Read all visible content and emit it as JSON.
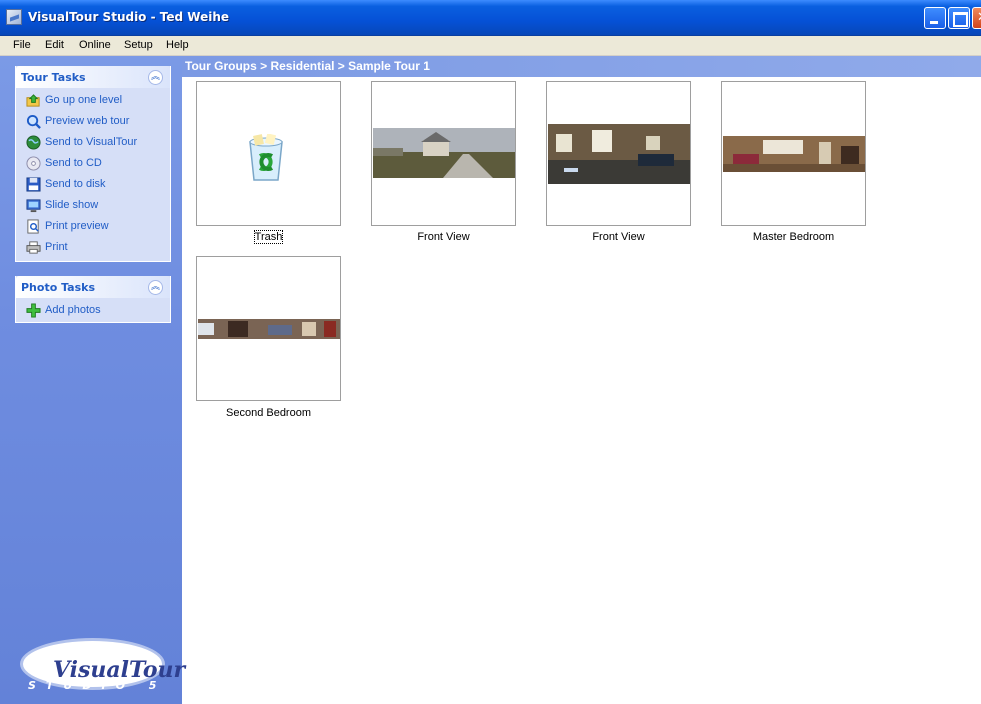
{
  "window": {
    "title": "VisualTour Studio - Ted Weihe"
  },
  "menu": [
    "File",
    "Edit",
    "Online",
    "Setup",
    "Help"
  ],
  "tour_tasks": {
    "title": "Tour Tasks",
    "items": [
      {
        "label": "Go up one level",
        "icon": "folder-up-icon"
      },
      {
        "label": "Preview web tour",
        "icon": "magnifier-icon"
      },
      {
        "label": "Send to VisualTour",
        "icon": "globe-icon"
      },
      {
        "label": "Send to CD",
        "icon": "cd-icon"
      },
      {
        "label": "Send to disk",
        "icon": "floppy-icon"
      },
      {
        "label": "Slide show",
        "icon": "monitor-icon"
      },
      {
        "label": "Print preview",
        "icon": "print-preview-icon"
      },
      {
        "label": "Print",
        "icon": "printer-icon"
      }
    ]
  },
  "photo_tasks": {
    "title": "Photo Tasks",
    "items": [
      {
        "label": "Add photos",
        "icon": "add-icon"
      }
    ]
  },
  "logo": {
    "word": "VisualTour",
    "sub": "STUDIO 5"
  },
  "breadcrumb": "Tour Groups > Residential > Sample Tour 1",
  "thumbnails": [
    {
      "label": "Trash",
      "kind": "recycle-bin"
    },
    {
      "label": "Front View",
      "kind": "panorama"
    },
    {
      "label": "Front View",
      "kind": "panorama"
    },
    {
      "label": "Master Bedroom",
      "kind": "panorama"
    },
    {
      "label": "Second Bedroom",
      "kind": "panorama"
    }
  ],
  "colors": {
    "title_bar": "#0551d6",
    "task_pane": "#6f8de0",
    "link": "#215dc6"
  }
}
